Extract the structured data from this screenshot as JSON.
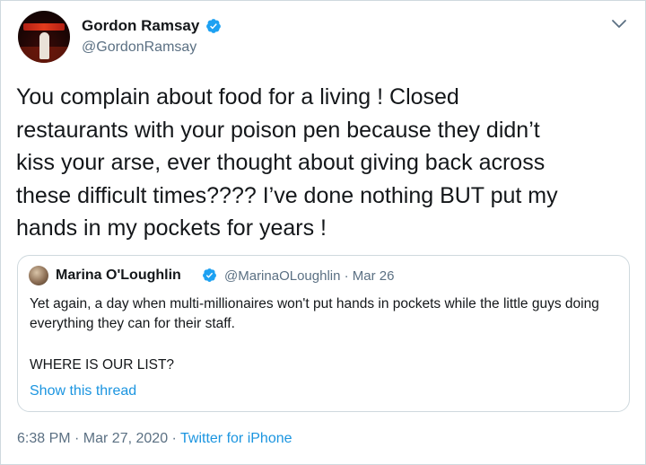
{
  "author": {
    "name": "Gordon Ramsay",
    "handle": "@GordonRamsay",
    "avatar_icon": "profile-photo"
  },
  "tweet": {
    "text": "You complain about food for a living ! Closed\nrestaurants with your poison pen because they didn’t\nkiss your arse, ever thought about giving back across\nthese difficult times???? I’ve done  nothing BUT  put my\nhands in my pockets for years !"
  },
  "quoted": {
    "name": "Marina O'Loughlin",
    "meta": "@MarinaOLoughlin · Mar 26",
    "text": "Yet again, a day when multi-millionaires won't put hands in pockets while the little guys doing everything they can for their staff.",
    "text2": "WHERE IS OUR LIST?",
    "thread_link": "Show this thread"
  },
  "footer": {
    "timestamp": "6:38 PM · Mar 27, 2020 · ",
    "source": "Twitter for iPhone"
  },
  "colors": {
    "verified": "#1da1f2",
    "link": "#1b95e0",
    "secondary_text": "#5b7083",
    "border": "#cfd9de"
  }
}
